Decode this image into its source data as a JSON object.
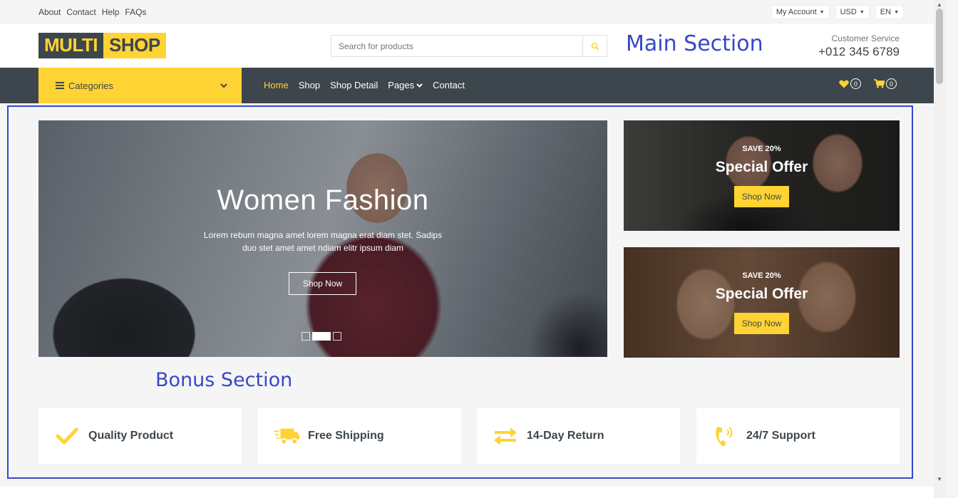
{
  "topbar": {
    "links": [
      "About",
      "Contact",
      "Help",
      "FAQs"
    ],
    "account": "My Account",
    "currency": "USD",
    "language": "EN"
  },
  "header": {
    "logo_part1": "MULTI",
    "logo_part2": "SHOP",
    "search_placeholder": "Search for products",
    "annotation": "Main Section",
    "customer_label": "Customer Service",
    "customer_phone": "+012 345 6789"
  },
  "nav": {
    "categories_label": "Categories",
    "links": [
      "Home",
      "Shop",
      "Shop Detail",
      "Pages",
      "Contact"
    ],
    "active_link": "Home",
    "wishlist_count": "0",
    "cart_count": "0"
  },
  "carousel": {
    "title": "Women Fashion",
    "description": "Lorem rebum magna amet lorem magna erat diam stet. Sadips duo stet amet amet ndiam elitr ipsum diam",
    "button": "Shop Now",
    "slides": 3,
    "active_slide": 2
  },
  "offers": [
    {
      "save": "SAVE 20%",
      "title": "Special Offer",
      "button": "Shop Now"
    },
    {
      "save": "SAVE 20%",
      "title": "Special Offer",
      "button": "Shop Now"
    }
  ],
  "bonus_annotation": "Bonus Section",
  "features": [
    {
      "icon": "check-icon",
      "label": "Quality Product"
    },
    {
      "icon": "truck-icon",
      "label": "Free Shipping"
    },
    {
      "icon": "exchange-icon",
      "label": "14-Day Return"
    },
    {
      "icon": "phone-volume-icon",
      "label": "24/7 Support"
    }
  ],
  "colors": {
    "accent": "#FFD333",
    "dark": "#3D464D",
    "annotation": "#3747C8"
  }
}
